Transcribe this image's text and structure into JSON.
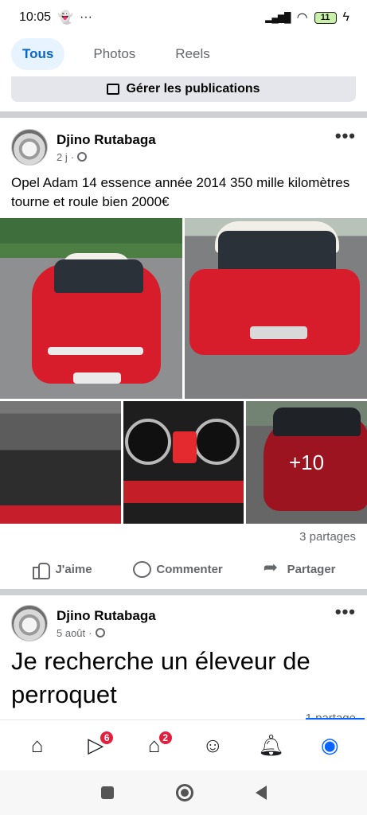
{
  "status_bar": {
    "time": "10:05",
    "battery": "11"
  },
  "filters": {
    "tabs": [
      "Tous",
      "Photos",
      "Reels"
    ],
    "active": "Tous"
  },
  "manage_button": {
    "label": "Gérer les publications"
  },
  "post1": {
    "author": "Djino Rutabaga",
    "time": "2 j",
    "text": "Opel Adam 14 essence année 2014 350 mille kilomètres tourne et roule bien 2000€",
    "more_photos": "+10",
    "shares": "3 partages",
    "actions": {
      "like": "J'aime",
      "comment": "Commenter",
      "share": "Partager"
    }
  },
  "post2": {
    "author": "Djino Rutabaga",
    "time": "5 août",
    "text": "Je recherche un éleveur de perroquet",
    "shares_partial": "1 partage"
  },
  "bottom_nav": {
    "items": [
      {
        "icon": "home-icon",
        "badge": ""
      },
      {
        "icon": "video-icon",
        "badge": "6"
      },
      {
        "icon": "marketplace-icon",
        "badge": "2"
      },
      {
        "icon": "groups-icon",
        "badge": ""
      },
      {
        "icon": "bell-icon",
        "badge": ""
      },
      {
        "icon": "profile-icon",
        "badge": ""
      }
    ]
  },
  "colors": {
    "accent": "#0866ff",
    "badge": "#e41e3f",
    "text_secondary": "#65676b"
  }
}
